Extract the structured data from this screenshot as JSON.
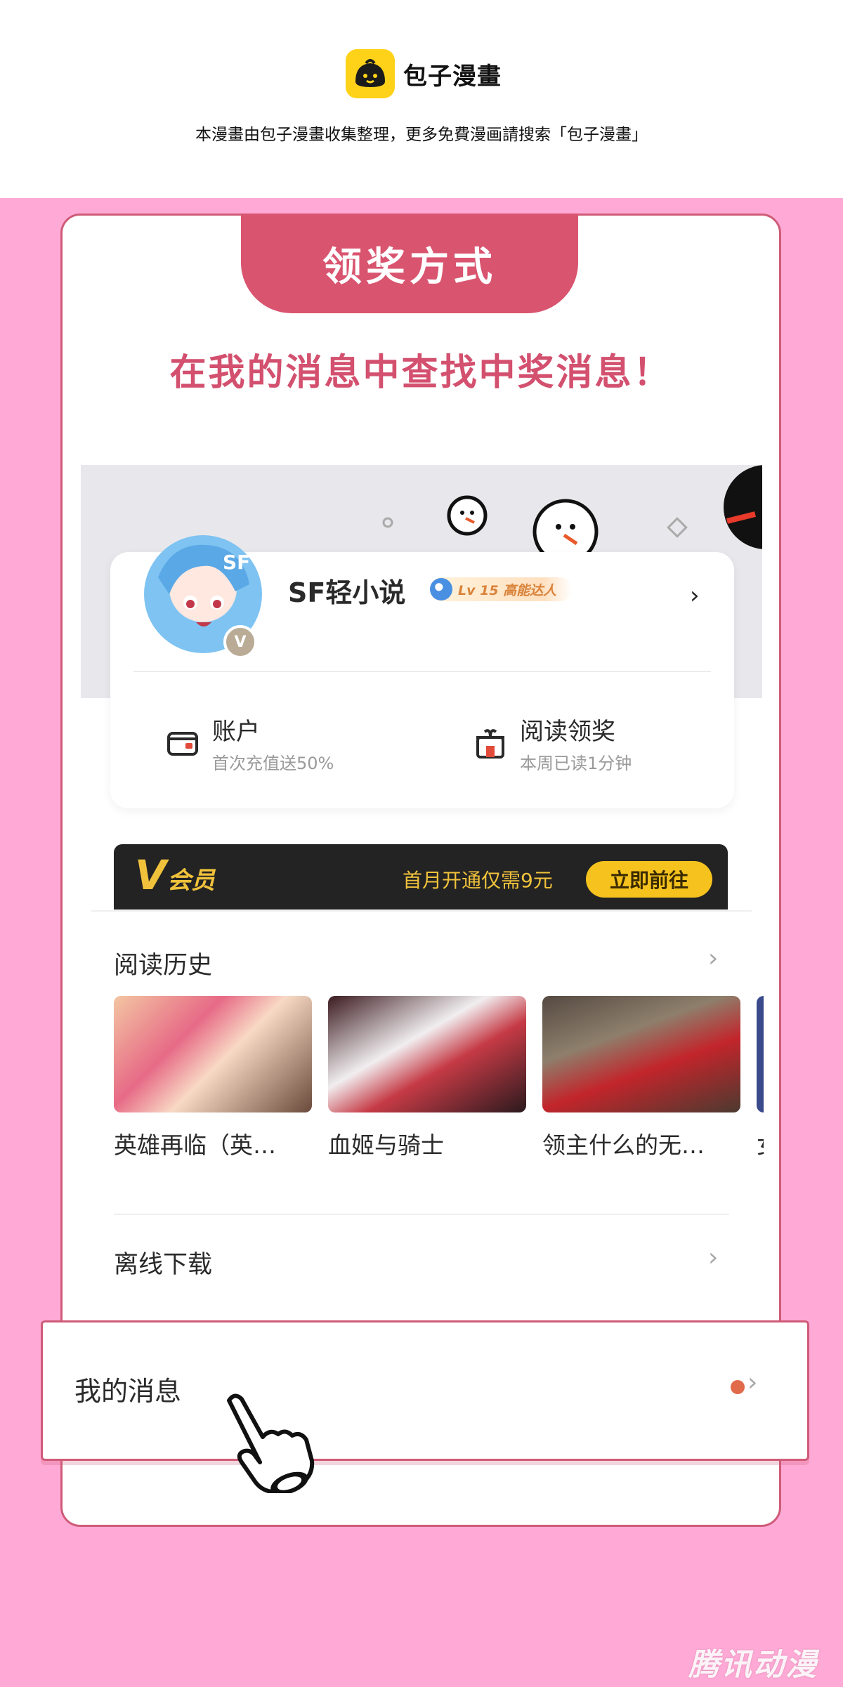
{
  "top_banner": {
    "logo_name": "包子漫畫",
    "subtitle": "本漫畫由包子漫畫收集整理，更多免費漫画請搜索「包子漫畫」"
  },
  "card": {
    "tab_title": "领奖方式",
    "instruction": "在我的消息中查找中奖消息！"
  },
  "profile": {
    "avatar_badge": "V",
    "username": "SF轻小说",
    "level": "Lv 15 高能达人",
    "chevron": "›"
  },
  "features": [
    {
      "title": "账户",
      "subtitle": "首次充值送50%",
      "icon": "wallet-icon"
    },
    {
      "title": "阅读领奖",
      "subtitle": "本周已读1分钟",
      "icon": "gift-icon"
    }
  ],
  "vip": {
    "logo_v": "V",
    "label": "会员",
    "promo": "首月开通仅需9元",
    "button": "立即前往"
  },
  "reading_history": {
    "title": "阅读历史",
    "chevron": "›",
    "books": [
      {
        "title": "英雄再临（英…"
      },
      {
        "title": "血姬与骑士"
      },
      {
        "title": "领主什么的无…"
      },
      {
        "title": "女"
      }
    ]
  },
  "offline_download": {
    "title": "离线下载",
    "chevron": "›"
  },
  "my_messages": {
    "title": "我的消息",
    "chevron": "›"
  },
  "watermark": "腾讯动漫",
  "colors": {
    "page_bg": "#ffaad6",
    "accent": "#d9546f",
    "vip_gold": "#f0c23b",
    "unread_dot": "#e06a4a"
  }
}
